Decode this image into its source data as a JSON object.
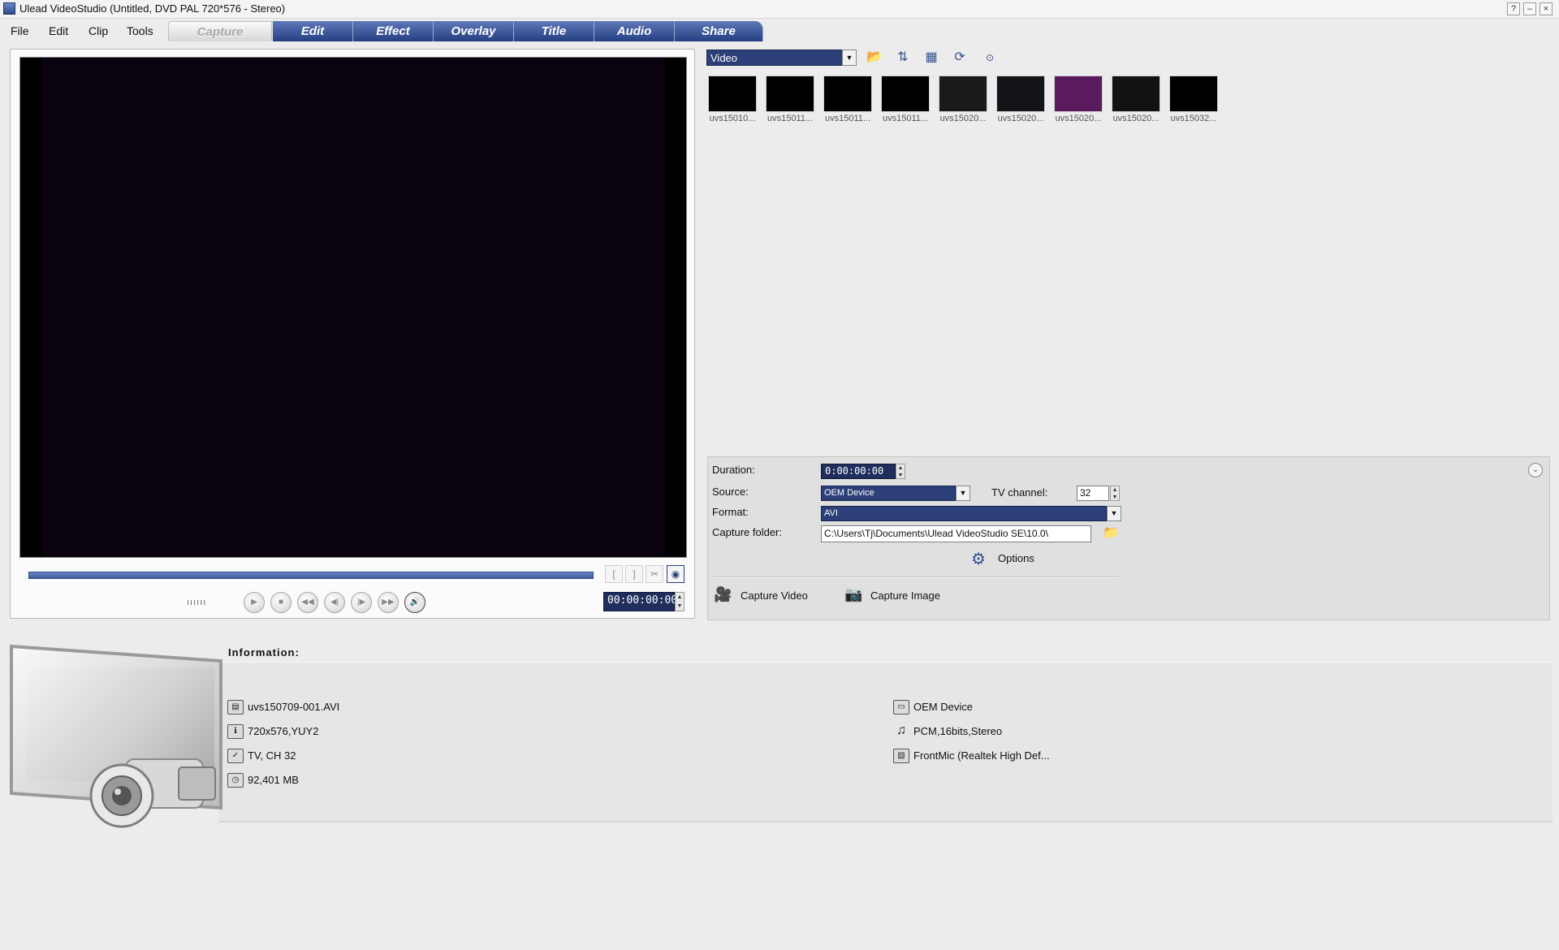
{
  "window": {
    "title": "Ulead VideoStudio (Untitled, DVD PAL 720*576 - Stereo)",
    "buttons": {
      "help": "?",
      "minimize": "–",
      "close": "×"
    }
  },
  "menu": [
    "File",
    "Edit",
    "Clip",
    "Tools"
  ],
  "tabs": [
    "Capture",
    "Edit",
    "Effect",
    "Overlay",
    "Title",
    "Audio",
    "Share"
  ],
  "active_tab": "Capture",
  "preview": {
    "timecode": "00:00:00:00",
    "trim_buttons": {
      "mark_in": "[",
      "mark_out": "]"
    },
    "jog_dial": "ıııııı"
  },
  "library": {
    "category": "Video",
    "thumbnails": [
      {
        "label": "uvs15010...",
        "color": "#000000"
      },
      {
        "label": "uvs15011...",
        "color": "#000000"
      },
      {
        "label": "uvs15011...",
        "color": "#000000"
      },
      {
        "label": "uvs15011...",
        "color": "#000000"
      },
      {
        "label": "uvs15020...",
        "color": "#1a1a1a"
      },
      {
        "label": "uvs15020...",
        "color": "#141418"
      },
      {
        "label": "uvs15020...",
        "color": "#5a1a5e"
      },
      {
        "label": "uvs15020...",
        "color": "#121214"
      },
      {
        "label": "uvs15032...",
        "color": "#000000"
      }
    ]
  },
  "capture_options": {
    "duration_label": "Duration:",
    "duration_value": "0:00:00:00",
    "source_label": "Source:",
    "source_value": "OEM Device",
    "tv_channel_label": "TV channel:",
    "tv_channel_value": "32",
    "format_label": "Format:",
    "format_value": "AVI",
    "capture_folder_label": "Capture folder:",
    "capture_folder_value": "C:\\Users\\Tj\\Documents\\Ulead VideoStudio SE\\10.0\\",
    "options_label": "Options",
    "capture_video_label": "Capture Video",
    "capture_image_label": "Capture Image"
  },
  "information": {
    "title": "Information:",
    "left": [
      {
        "icon": "film-icon",
        "text": "uvs150709-001.AVI"
      },
      {
        "icon": "resolution-icon",
        "text": "720x576,YUY2"
      },
      {
        "icon": "check-icon",
        "text": "TV, CH 32"
      },
      {
        "icon": "disk-icon",
        "text": "92,401 MB"
      }
    ],
    "right": [
      {
        "icon": "device-icon",
        "text": "OEM Device"
      },
      {
        "icon": "music-note-icon",
        "text": "PCM,16bits,Stereo"
      },
      {
        "icon": "microphone-icon",
        "text": "FrontMic (Realtek High Def..."
      }
    ]
  },
  "colors": {
    "tab_blue": "#2e4a8c",
    "dropdown_blue": "#2c3f78",
    "preview_bg": "#0b0210"
  }
}
